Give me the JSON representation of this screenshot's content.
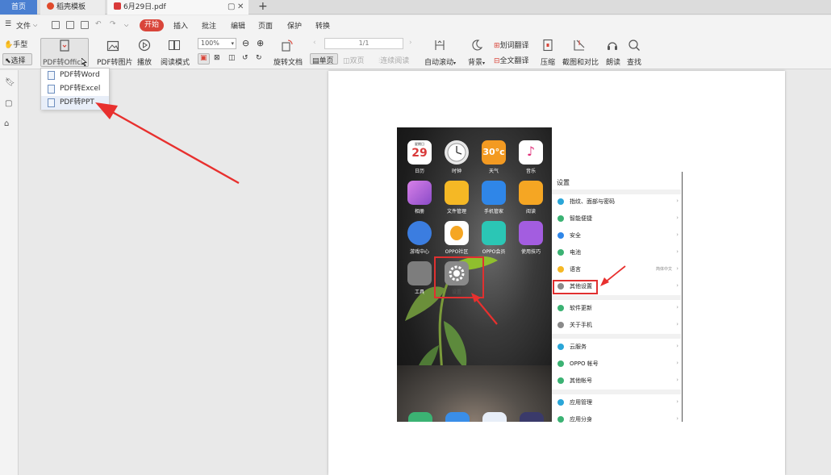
{
  "tabs": {
    "home": "首页",
    "templates": "稻壳模板",
    "document": "6月29日.pdf",
    "close_glyph": "✕",
    "restore_glyph": "▢",
    "new_tab_glyph": "+"
  },
  "menubar": {
    "file_menu": "文件",
    "items": [
      "开始",
      "插入",
      "批注",
      "编辑",
      "页面",
      "保护",
      "转换"
    ]
  },
  "toolbar": {
    "hand": "手型",
    "select": "选择",
    "pdf_to_office": "PDF转Office",
    "pdf_to_image": "PDF转图片",
    "play": "播放",
    "read_mode": "阅读模式",
    "zoom": "100%",
    "rotate_doc": "旋转文档",
    "page_indicator": "1/1",
    "single_page": "单页",
    "double_page": "双页",
    "continuous": "连续阅读",
    "auto_scroll": "自动滚动",
    "background": "背景",
    "translate_word": "划词翻译",
    "translate_full": "全文翻译",
    "compress": "压缩",
    "screenshot_compare": "截图和对比",
    "read_aloud": "朗读",
    "find": "查找"
  },
  "dropdown": {
    "items": [
      "PDF转Word",
      "PDF转Excel",
      "PDF转PPT"
    ]
  },
  "phone": {
    "calendar_day": "29",
    "calendar_weekday": "星期日",
    "weather_temp": "30°c",
    "apps": [
      {
        "label": "日历",
        "color": "#ffffff"
      },
      {
        "label": "时钟",
        "color": "#e8e8e8"
      },
      {
        "label": "天气",
        "color": "#f39a22"
      },
      {
        "label": "音乐",
        "color": "#ffffff"
      },
      {
        "label": "相册",
        "color": "#b85bd6"
      },
      {
        "label": "文件管理",
        "color": "#f5b825"
      },
      {
        "label": "手机管家",
        "color": "#2f86e8"
      },
      {
        "label": "阅读",
        "color": "#f5a623"
      },
      {
        "label": "游戏中心",
        "color": "#3b7de0"
      },
      {
        "label": "OPPO社区",
        "color": "#ffffff"
      },
      {
        "label": "OPPO会员",
        "color": "#2bc6b5"
      },
      {
        "label": "使用技巧",
        "color": "#a35de0"
      },
      {
        "label": "工具",
        "color": "#7d7d7d"
      },
      {
        "label": "设置",
        "color": "#8a8a8a"
      }
    ]
  },
  "settings": {
    "title": "设置",
    "rows": [
      {
        "label": "指纹、面部与密码",
        "color": "#2aa6d8",
        "value": ""
      },
      {
        "label": "智能便捷",
        "color": "#3bb273",
        "value": ""
      },
      {
        "label": "安全",
        "color": "#2f86e8",
        "value": ""
      },
      {
        "label": "电池",
        "color": "#3bb273",
        "value": ""
      },
      {
        "label": "语言",
        "color": "#f5b825",
        "value": "简体中文"
      },
      {
        "label": "其他设置",
        "color": "#8a8a8a",
        "value": ""
      },
      {
        "label": "软件更新",
        "color": "#3bb273",
        "value": ""
      },
      {
        "label": "关于手机",
        "color": "#8a8a8a",
        "value": ""
      },
      {
        "label": "云服务",
        "color": "#2aa6d8",
        "value": ""
      },
      {
        "label": "OPPO 帐号",
        "color": "#3bb273",
        "value": ""
      },
      {
        "label": "其他帐号",
        "color": "#3bb273",
        "value": ""
      },
      {
        "label": "应用管理",
        "color": "#2aa6d8",
        "value": ""
      },
      {
        "label": "应用分身",
        "color": "#3bb273",
        "value": ""
      }
    ],
    "arrow": "›"
  },
  "colors": {
    "accent_red": "#d9453a",
    "arrow_red": "#e8302e",
    "tab_blue": "#4a7fd1"
  }
}
